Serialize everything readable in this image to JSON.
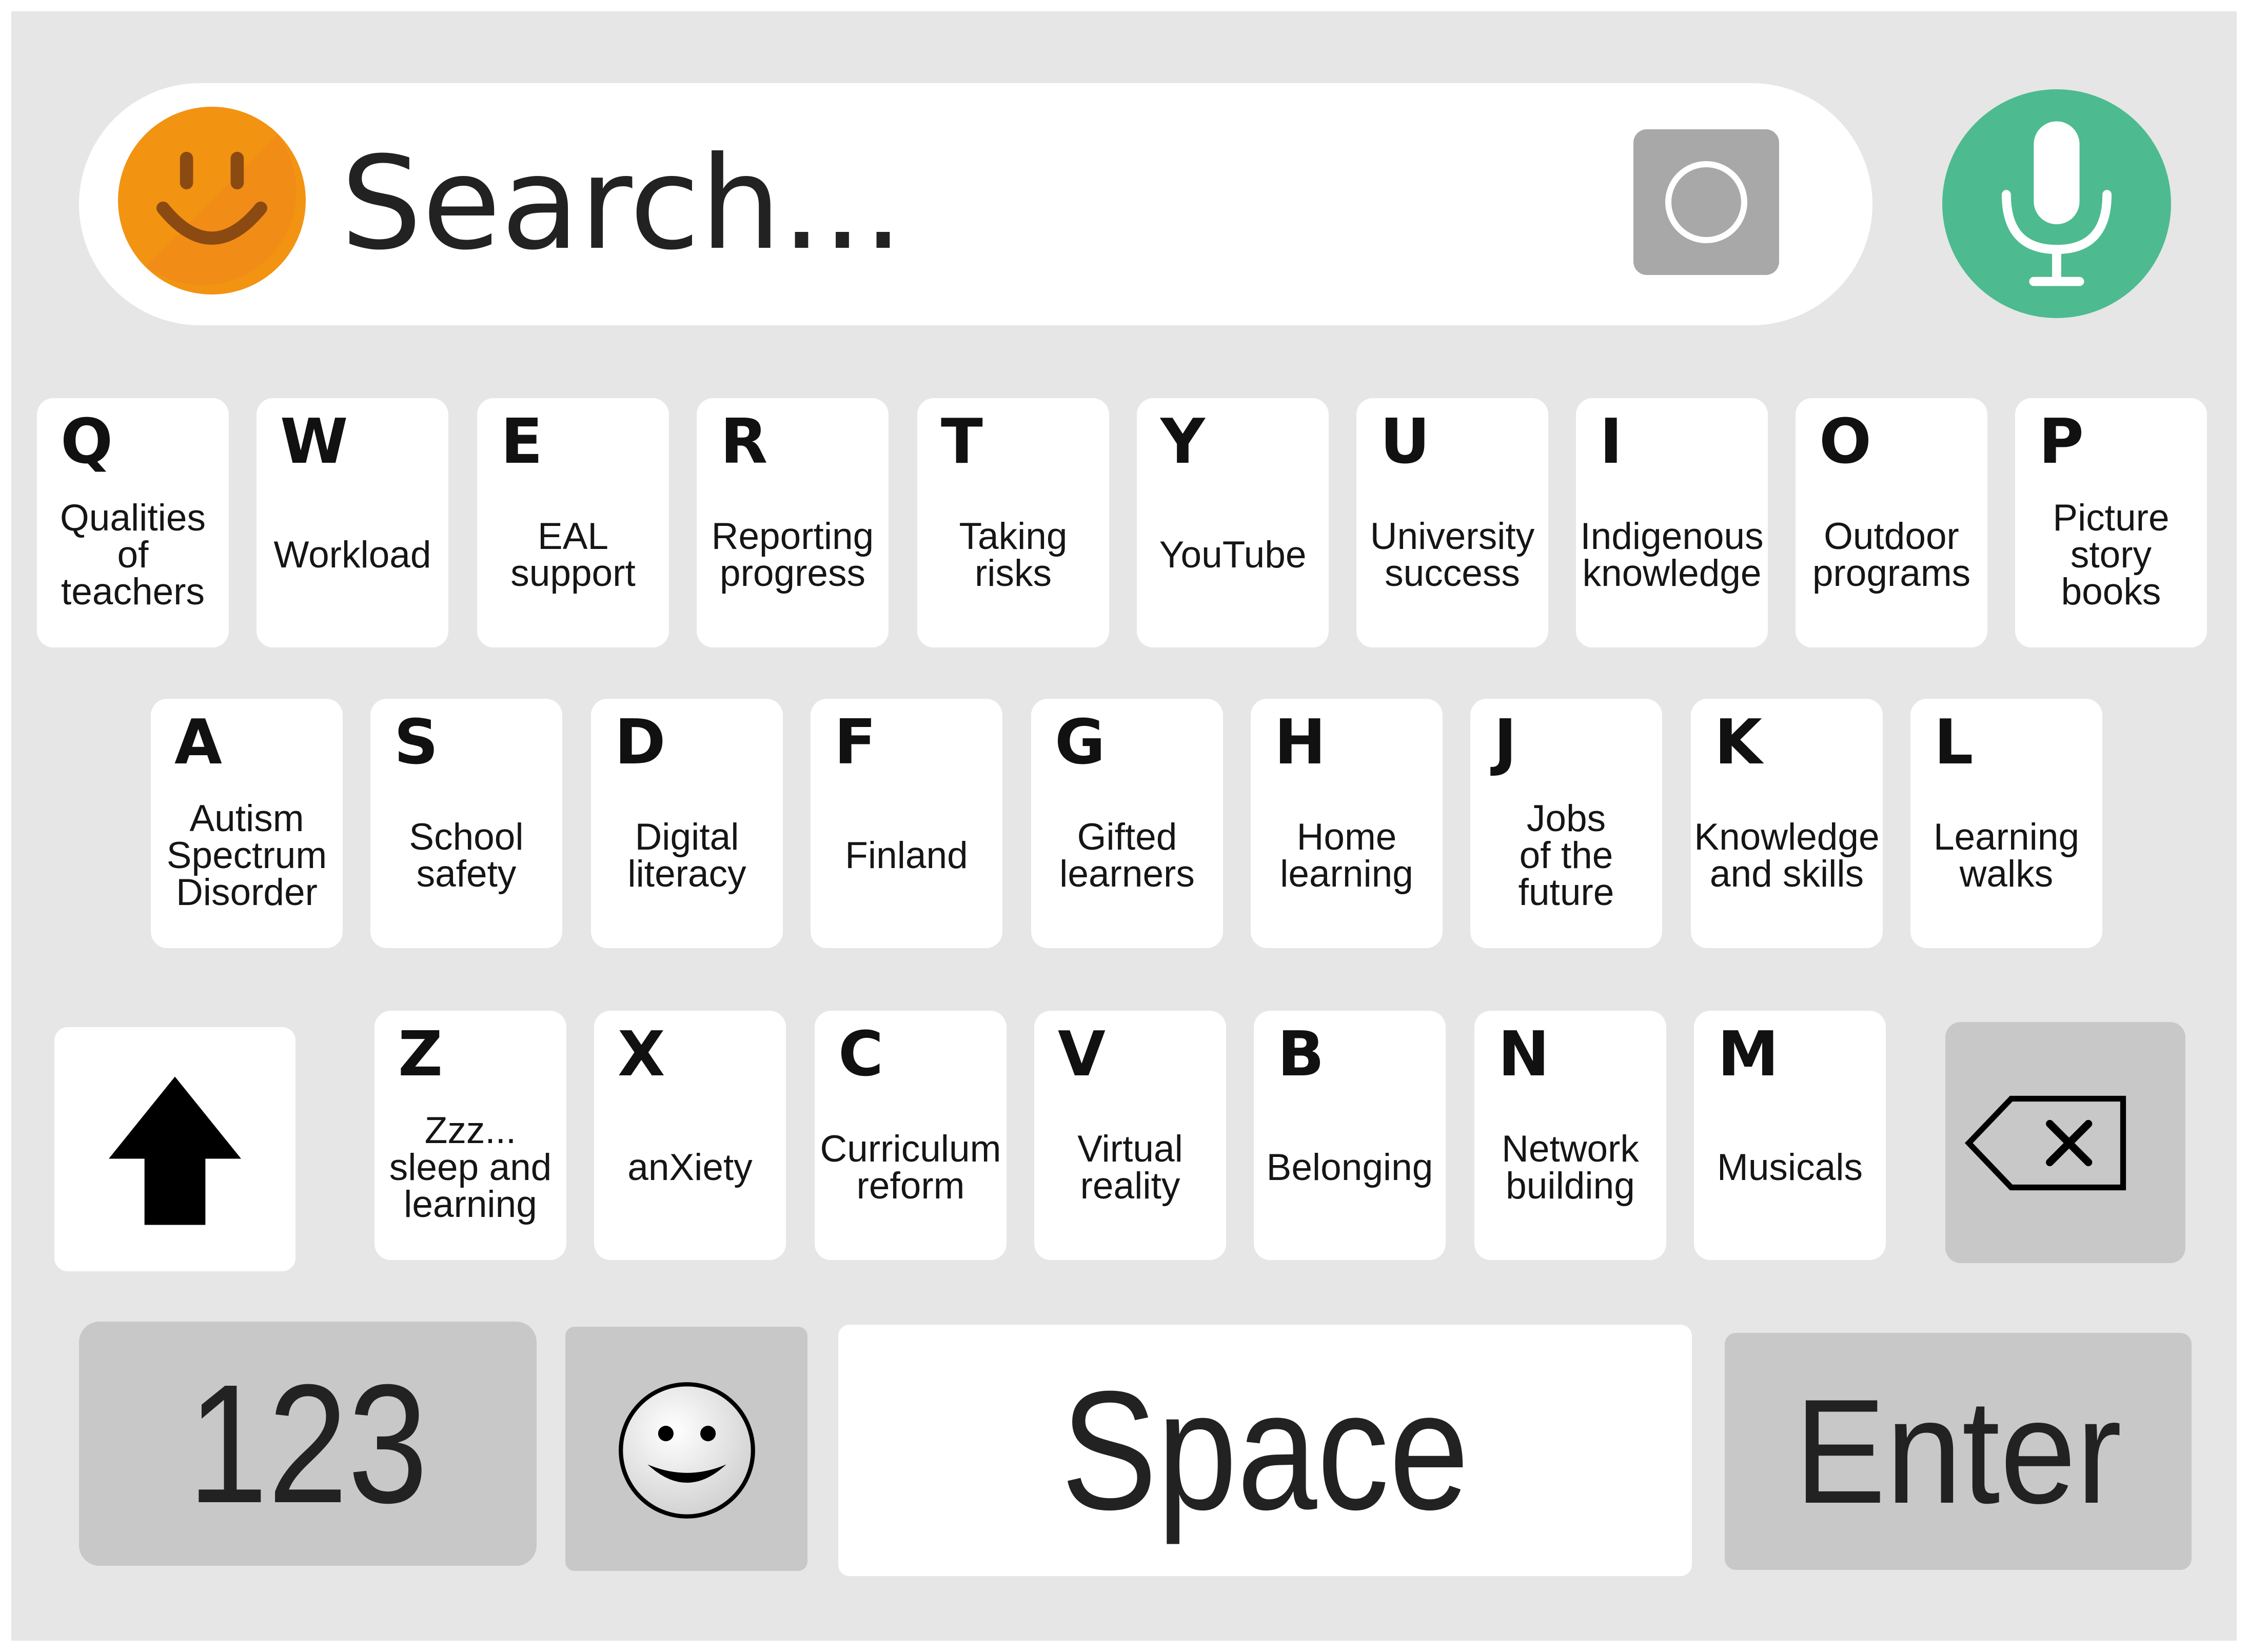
{
  "search": {
    "placeholder": "Search...",
    "colors": {
      "smiley": "#f29312",
      "mic": "#4dbb8f",
      "camera": "#a8a8a8"
    }
  },
  "rows": [
    [
      {
        "letter": "Q",
        "label": "Qualities\nof\nteachers"
      },
      {
        "letter": "W",
        "label": "Workload"
      },
      {
        "letter": "E",
        "label": "EAL\nsupport"
      },
      {
        "letter": "R",
        "label": "Reporting\nprogress"
      },
      {
        "letter": "T",
        "label": "Taking\nrisks"
      },
      {
        "letter": "Y",
        "label": "YouTube"
      },
      {
        "letter": "U",
        "label": "University\nsuccess"
      },
      {
        "letter": "I",
        "label": "Indigenous\nknowledge"
      },
      {
        "letter": "O",
        "label": "Outdoor\nprograms"
      },
      {
        "letter": "P",
        "label": "Picture\nstory\nbooks"
      }
    ],
    [
      {
        "letter": "A",
        "label": "Autism\nSpectrum\nDisorder"
      },
      {
        "letter": "S",
        "label": "School\nsafety"
      },
      {
        "letter": "D",
        "label": "Digital\nliteracy"
      },
      {
        "letter": "F",
        "label": "Finland"
      },
      {
        "letter": "G",
        "label": "Gifted\nlearners"
      },
      {
        "letter": "H",
        "label": "Home\nlearning"
      },
      {
        "letter": "J",
        "label": "Jobs\nof the\nfuture"
      },
      {
        "letter": "K",
        "label": "Knowledge\nand skills"
      },
      {
        "letter": "L",
        "label": "Learning\nwalks"
      }
    ],
    [
      {
        "letter": "Z",
        "label": "Zzz...\nsleep and\nlearning"
      },
      {
        "letter": "X",
        "label": "anXiety"
      },
      {
        "letter": "C",
        "label": "Curriculum\nreform"
      },
      {
        "letter": "V",
        "label": "Virtual\nreality"
      },
      {
        "letter": "B",
        "label": "Belonging"
      },
      {
        "letter": "N",
        "label": "Network\nbuilding"
      },
      {
        "letter": "M",
        "label": "Musicals"
      }
    ]
  ],
  "bottom": {
    "numbers": "123",
    "space": "Space",
    "enter": "Enter"
  },
  "icons": {
    "search_left": "smiley-face-icon",
    "camera": "camera-shutter-icon",
    "mic": "microphone-icon",
    "shift": "shift-arrow-icon",
    "backspace": "backspace-icon",
    "emoji": "emoji-smiley-icon"
  }
}
